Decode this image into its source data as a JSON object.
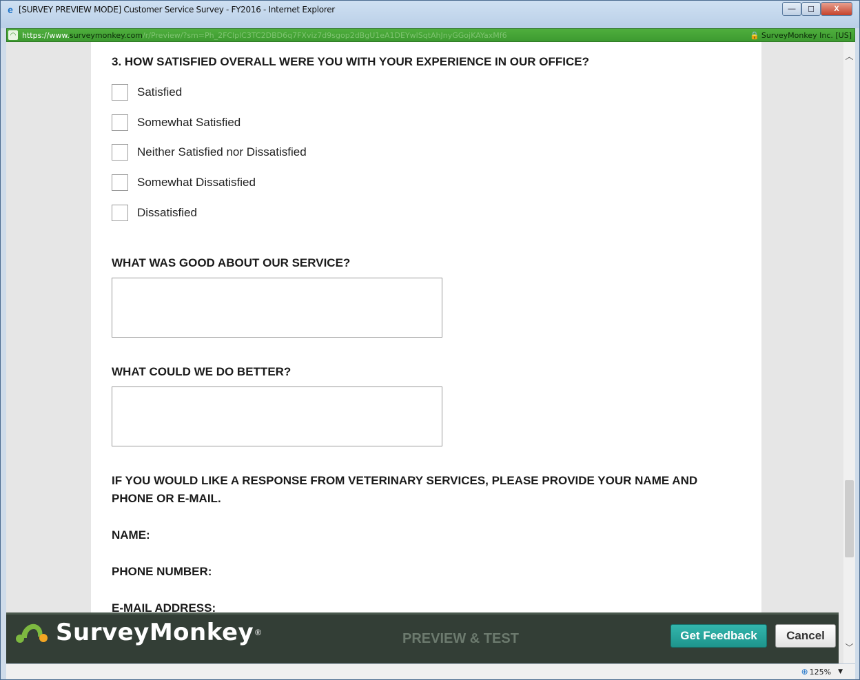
{
  "window": {
    "title": "[SURVEY PREVIEW MODE] Customer Service Survey - FY2016 - Internet Explorer",
    "minimize_label": "—",
    "maximize_label": "☐",
    "close_label": "X"
  },
  "address": {
    "scheme": "https://www.",
    "domain": "surveymonkey.com",
    "path": "/r/Preview/?sm=Ph_2FClplC3TC2DBD6q7FXviz7d9sgop2dBgU1eA1DEYwlSqtAhJnyGGojKAYaxMf6",
    "certificate": "SurveyMonkey Inc. [US]"
  },
  "survey": {
    "q3_title": "3. HOW SATISFIED OVERALL WERE YOU WITH YOUR EXPERIENCE IN OUR OFFICE?",
    "q3_options": [
      "Satisfied",
      "Somewhat Satisfied",
      "Neither Satisfied nor Dissatisfied",
      "Somewhat Dissatisfied",
      "Dissatisfied"
    ],
    "good_title": "WHAT WAS GOOD ABOUT OUR SERVICE?",
    "good_value": "",
    "better_title": "WHAT COULD WE DO BETTER?",
    "better_value": "",
    "response_title_line1": "IF YOU WOULD LIKE A RESPONSE FROM VETERINARY SERVICES, PLEASE PROVIDE YOUR NAME AND",
    "response_title_line2": "PHONE OR E-MAIL.",
    "name_label": "NAME:",
    "phone_label": "PHONE NUMBER:",
    "email_label": "E-MAIL ADDRESS:"
  },
  "footer": {
    "brand": "SurveyMonkey",
    "registered": "®",
    "mode_text": "PREVIEW & TEST",
    "feedback_button": "Get Feedback",
    "cancel_button": "Cancel"
  },
  "status": {
    "zoom": "125%"
  },
  "colors": {
    "address_bar": "#3d9a30",
    "footer_bg": "#333e36",
    "feedback_button": "#1e948c",
    "logo_green": "#7db940",
    "logo_orange": "#f4a623"
  }
}
